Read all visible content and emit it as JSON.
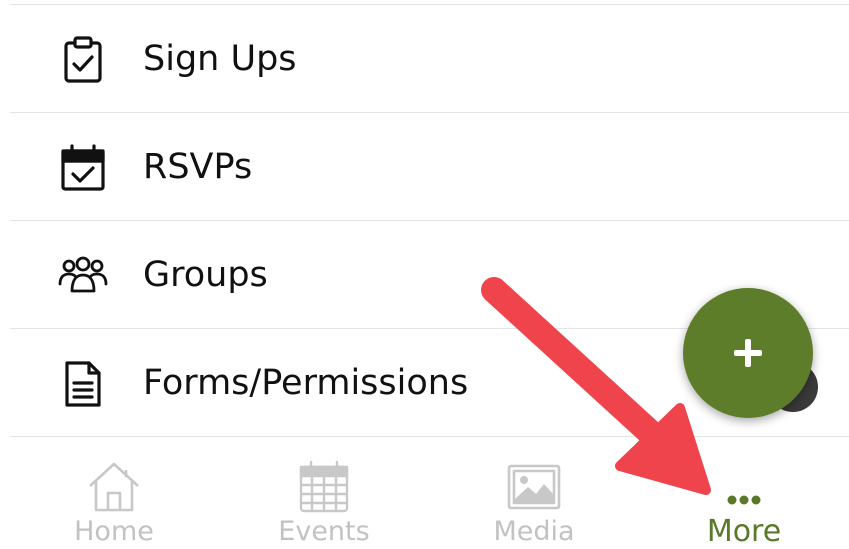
{
  "menu": {
    "items": [
      {
        "label": "Sign Ups",
        "icon": "clipboard-check-icon"
      },
      {
        "label": "RSVPs",
        "icon": "calendar-check-icon"
      },
      {
        "label": "Groups",
        "icon": "people-group-icon"
      },
      {
        "label": "Forms/Permissions",
        "icon": "document-icon"
      }
    ]
  },
  "fab": {
    "icon": "plus-icon",
    "color": "#5e7d2b"
  },
  "tabs": [
    {
      "label": "Home",
      "icon": "home-icon",
      "active": false
    },
    {
      "label": "Events",
      "icon": "calendar-icon",
      "active": false
    },
    {
      "label": "Media",
      "icon": "image-icon",
      "active": false
    },
    {
      "label": "More",
      "icon": "more-dots-icon",
      "active": true
    }
  ],
  "colors": {
    "accent": "#5e7d2b",
    "active_tab": "#5a7a2a",
    "inactive_tab": "#c2c2c2",
    "annotation_arrow": "#f0444d"
  },
  "annotation": {
    "icon": "red-arrow-icon"
  }
}
